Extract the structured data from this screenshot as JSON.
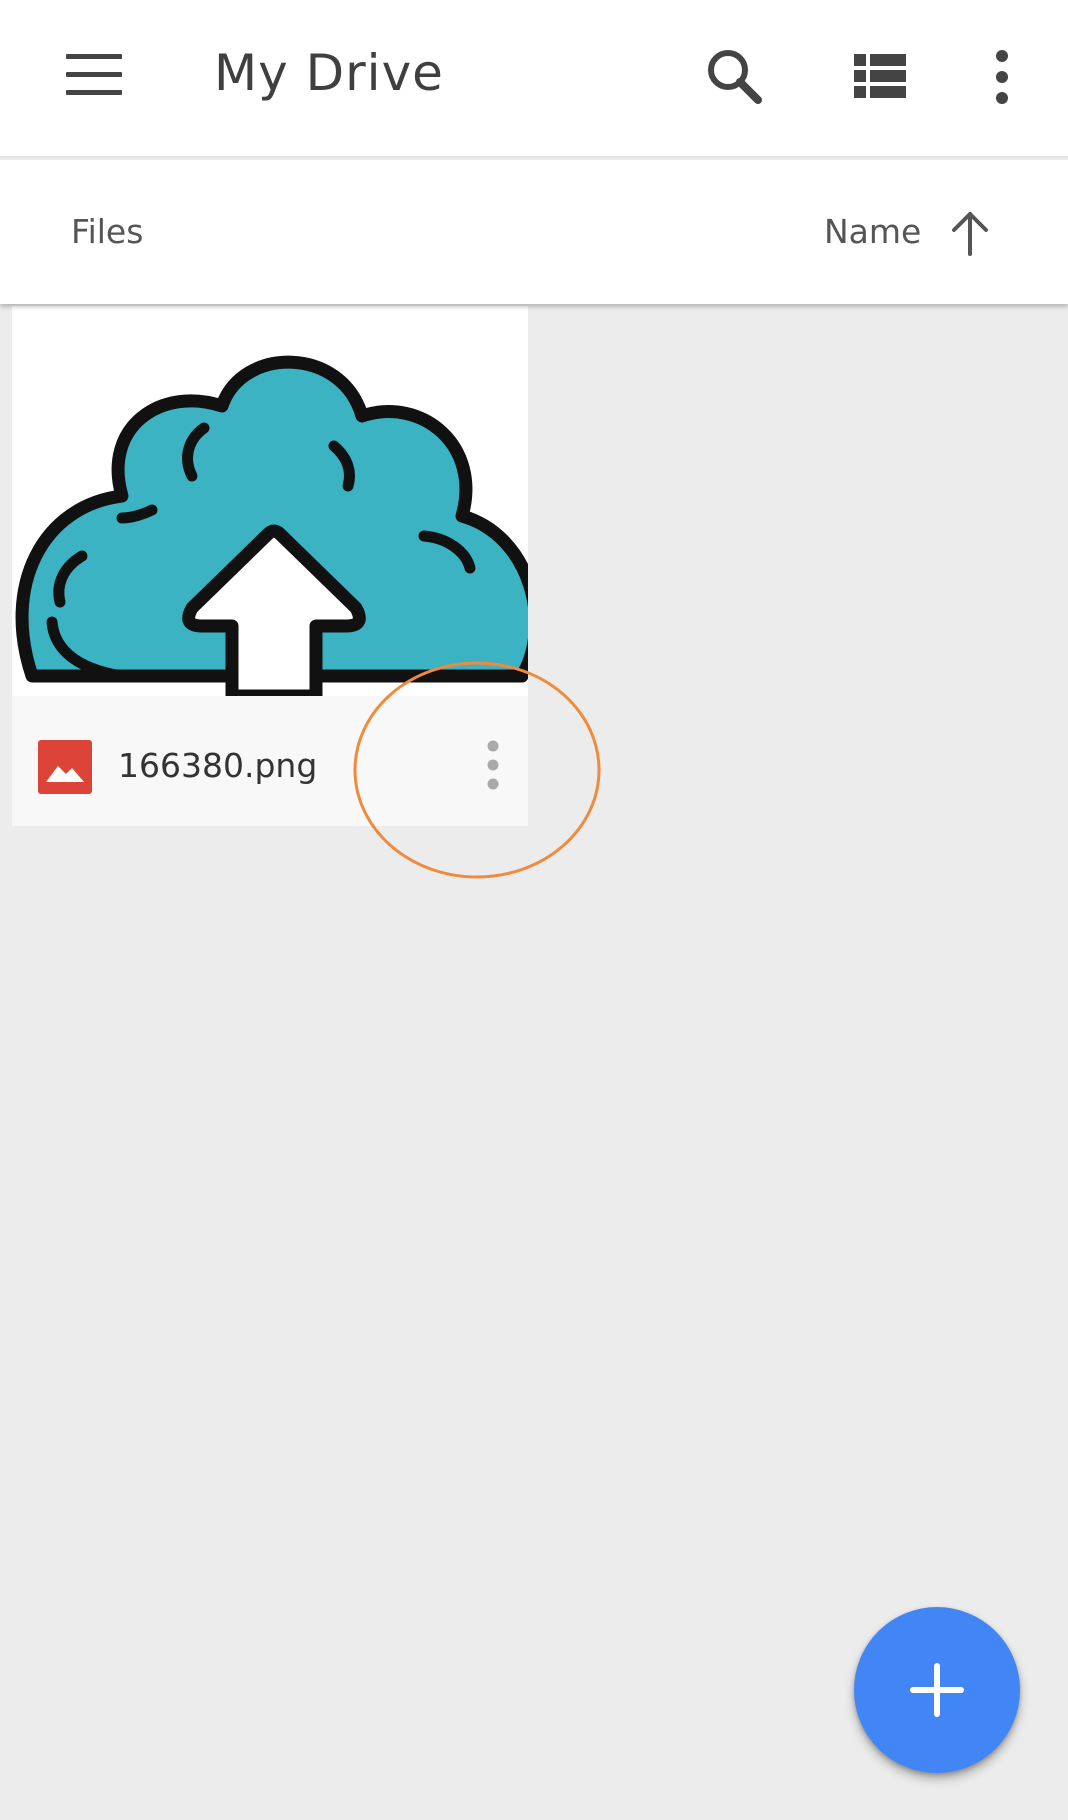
{
  "app_bar": {
    "title": "My Drive",
    "menu_icon": "hamburger-menu-icon",
    "search_icon": "search-icon",
    "view_toggle_icon": "list-view-icon",
    "more_icon": "more-vertical-icon"
  },
  "sort_bar": {
    "section_label": "Files",
    "sort_field": "Name",
    "sort_direction_icon": "arrow-up-icon"
  },
  "files": [
    {
      "name": "166380.png",
      "type_icon": "image-file-icon",
      "thumbnail_icon": "cloud-upload-icon",
      "more_icon": "more-vertical-icon"
    }
  ],
  "fab": {
    "icon": "plus-icon"
  },
  "colors": {
    "accent": "#4285f4",
    "highlight": "#f08a3c",
    "image_type": "#db4437",
    "cloud_fill": "#3bb3c3",
    "background": "#ececec"
  }
}
